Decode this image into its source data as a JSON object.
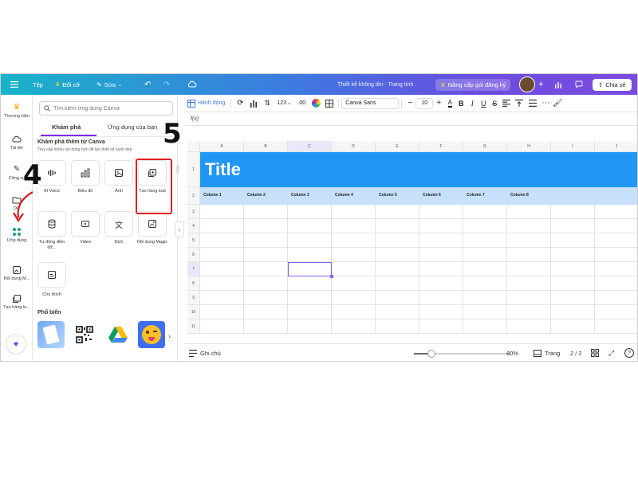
{
  "topbar": {
    "menu_icon": "hamburger-icon",
    "file": "Tệp",
    "change": "Đổi cỡ",
    "edit": "Sửa",
    "doc_title": "Thiết kế không tên - Trang tính",
    "upgrade": "Nâng cấp gói đăng ký",
    "share": "Chia sẻ",
    "colors": {
      "gradient_start": "#19b3c9",
      "gradient_end": "#7d4be0",
      "crown": "#f5c542"
    }
  },
  "rail": {
    "items": [
      {
        "label": "Thương hiệu",
        "icon": "crown-icon"
      },
      {
        "label": "Tải lên",
        "icon": "cloud-upload-icon"
      },
      {
        "label": "Công cụ",
        "icon": "pencil-icon"
      },
      {
        "label": "Dự",
        "icon": "folder-icon"
      },
      {
        "label": "Ứng dụng",
        "icon": "apps-grid-icon"
      },
      {
        "label": "Nội dung M...",
        "icon": "magic-image-icon"
      },
      {
        "label": "Tạo hàng lo...",
        "icon": "bulk-create-icon"
      }
    ],
    "magic_icon": "sparkle-icon"
  },
  "panel": {
    "search_placeholder": "Tìm kiếm ứng dụng Canva",
    "tabs": [
      "Khám phá",
      "Ứng dụng của bạn"
    ],
    "explore_title": "Khám phá thêm từ Canva",
    "explore_sub": "Truy cập nhiều nội dung hơn để tạo thiết kế tuyệt đẹp",
    "apps": [
      {
        "label": "AI Voice",
        "icon": "ai-voice-icon"
      },
      {
        "label": "Biểu đồ",
        "icon": "chart-icon"
      },
      {
        "label": "Ảnh",
        "icon": "image-icon"
      },
      {
        "label": "Tạo hàng loạt",
        "icon": "bulk-create-icon"
      },
      {
        "label": "Tự động điền dữ...",
        "icon": "database-icon"
      },
      {
        "label": "Video",
        "icon": "video-icon"
      },
      {
        "label": "Dịch",
        "icon": "translate-icon"
      },
      {
        "label": "Nội dung Magic",
        "icon": "magic-image-icon"
      },
      {
        "label": "Chú thích",
        "icon": "caption-icon"
      }
    ],
    "popular_title": "Phổ biến"
  },
  "annotations": {
    "step4": "4",
    "step5": "5",
    "highlight_color": "#e01e1e"
  },
  "toolbar": {
    "actions": "Hành động",
    "number_format": "123",
    "decimals": ".00",
    "font": "Canva Sans",
    "font_size": "10"
  },
  "formula": {
    "label": "f(x)"
  },
  "sheet": {
    "columns": [
      "A",
      "B",
      "C",
      "D",
      "E",
      "F",
      "G",
      "H",
      "I",
      "J"
    ],
    "rows": [
      "1",
      "2",
      "3",
      "4",
      "5",
      "6",
      "7",
      "8",
      "9",
      "10",
      "11"
    ],
    "title": "Title",
    "column_names": [
      "Column 1",
      "Column 2",
      "Column 3",
      "Column 4",
      "Column 5",
      "Column 6",
      "Column 7",
      "Column 8"
    ],
    "colors": {
      "title_band": "#2196f3",
      "header_band": "#c8e1fa",
      "selection": "#8b5cf6"
    }
  },
  "bottombar": {
    "notes": "Ghi chú",
    "zoom": "80%",
    "zoom_fraction": 0.18,
    "pages_label": "Trang",
    "page_count": "2 / 2"
  }
}
